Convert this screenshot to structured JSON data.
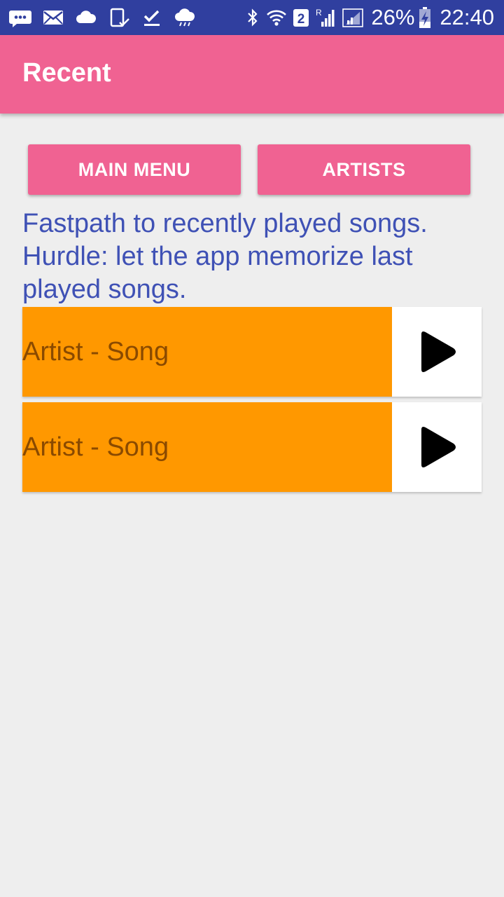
{
  "status_bar": {
    "battery": "26%",
    "time": "22:40",
    "sim_slot": "2",
    "roaming": "R",
    "left_icons": [
      "message-icon",
      "mail-icon",
      "cloud-icon",
      "device-check-icon",
      "download-done-icon",
      "weather-cloud-icon"
    ],
    "right_icons": [
      "bluetooth-icon",
      "wifi-icon",
      "sim-2-icon",
      "signal-roaming-icon",
      "signal-icon",
      "battery-charging-icon"
    ]
  },
  "app_bar": {
    "title": "Recent",
    "color": "#f06292"
  },
  "buttons": {
    "main_menu": "MAIN MENU",
    "artists": "ARTISTS"
  },
  "description": "Fastpath to recently played songs. Hurdle: let the app memorize last played songs.",
  "songs": [
    {
      "label": "Artist - Song",
      "action_icon": "play-icon"
    },
    {
      "label": "Artist - Song",
      "action_icon": "play-icon"
    }
  ],
  "colors": {
    "status_bar": "#303f9f",
    "accent": "#f06292",
    "description_text": "#3f51b5",
    "song_background": "#ff9800",
    "song_text": "#8a4a00",
    "page_background": "#eeeeee"
  }
}
